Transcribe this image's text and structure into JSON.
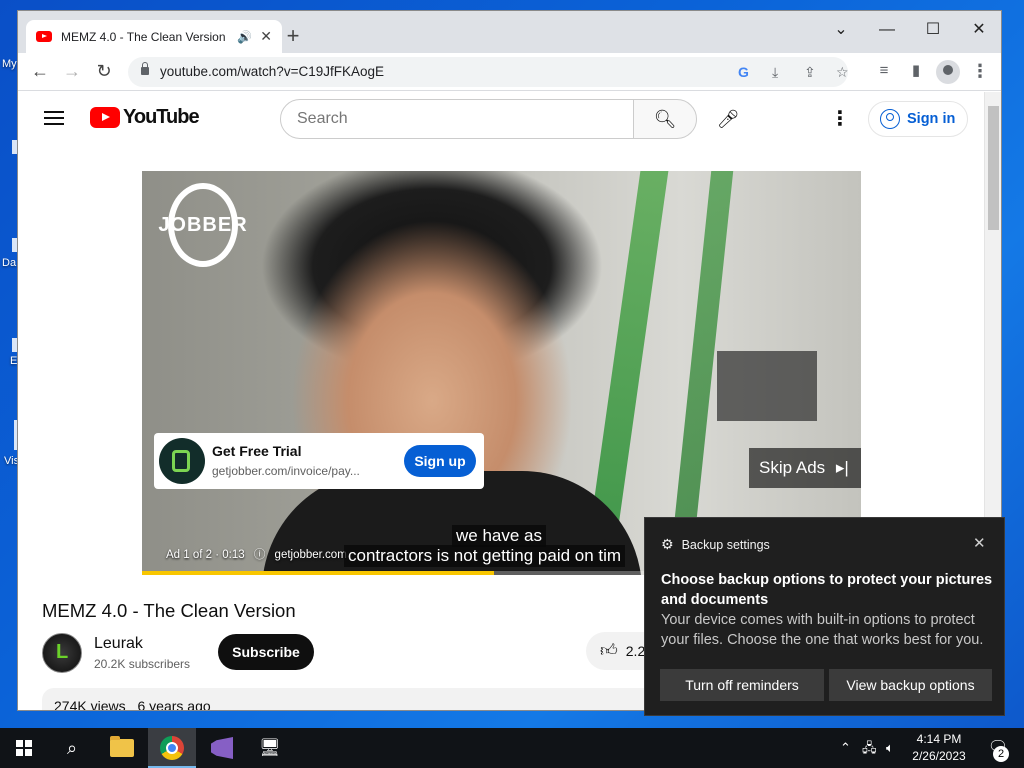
{
  "desktop": {
    "labels": [
      "My",
      "Da",
      "E",
      "Vis"
    ]
  },
  "browser": {
    "tab_title": "MEMZ 4.0 - The Clean Version",
    "url": "youtube.com/watch?v=C19JfFKAogE",
    "window_controls": [
      "chevron-down",
      "minimize",
      "maximize",
      "close"
    ]
  },
  "youtube": {
    "logo_text": "YouTube",
    "search_placeholder": "Search",
    "signin_label": "Sign in",
    "video_title": "MEMZ 4.0 - The Clean Version",
    "channel_name": "Leurak",
    "channel_subs": "20.2K subscribers",
    "subscribe_label": "Subscribe",
    "like_count": "2.2",
    "views": "274K views",
    "age": "6 years ago"
  },
  "ad": {
    "brand": "JOBBER",
    "title": "Get Free Trial",
    "url": "getjobber.com/invoice/pay...",
    "cta": "Sign up",
    "skip_label": "Skip Ads",
    "ad_counter": "Ad 1 of 2 · 0:13",
    "ad_domain": "getjobber.com",
    "caption_line1": "we have as",
    "caption_line2": "contractors is not getting paid on tim",
    "progress": 0.49
  },
  "toast": {
    "app": "Backup settings",
    "title": "Choose backup options to protect your pictures and documents",
    "body": "Your device comes with built-in options to protect your files. Choose the one that works best for you.",
    "btn_off": "Turn off reminders",
    "btn_view": "View backup options"
  },
  "taskbar": {
    "time": "4:14 PM",
    "date": "2/26/2023",
    "notification_count": "2"
  },
  "colors": {
    "youtube_red": "#ff0000",
    "link_blue": "#065fd4",
    "ad_yellow": "#f8c600",
    "toast_bg": "#1f1f1f"
  }
}
